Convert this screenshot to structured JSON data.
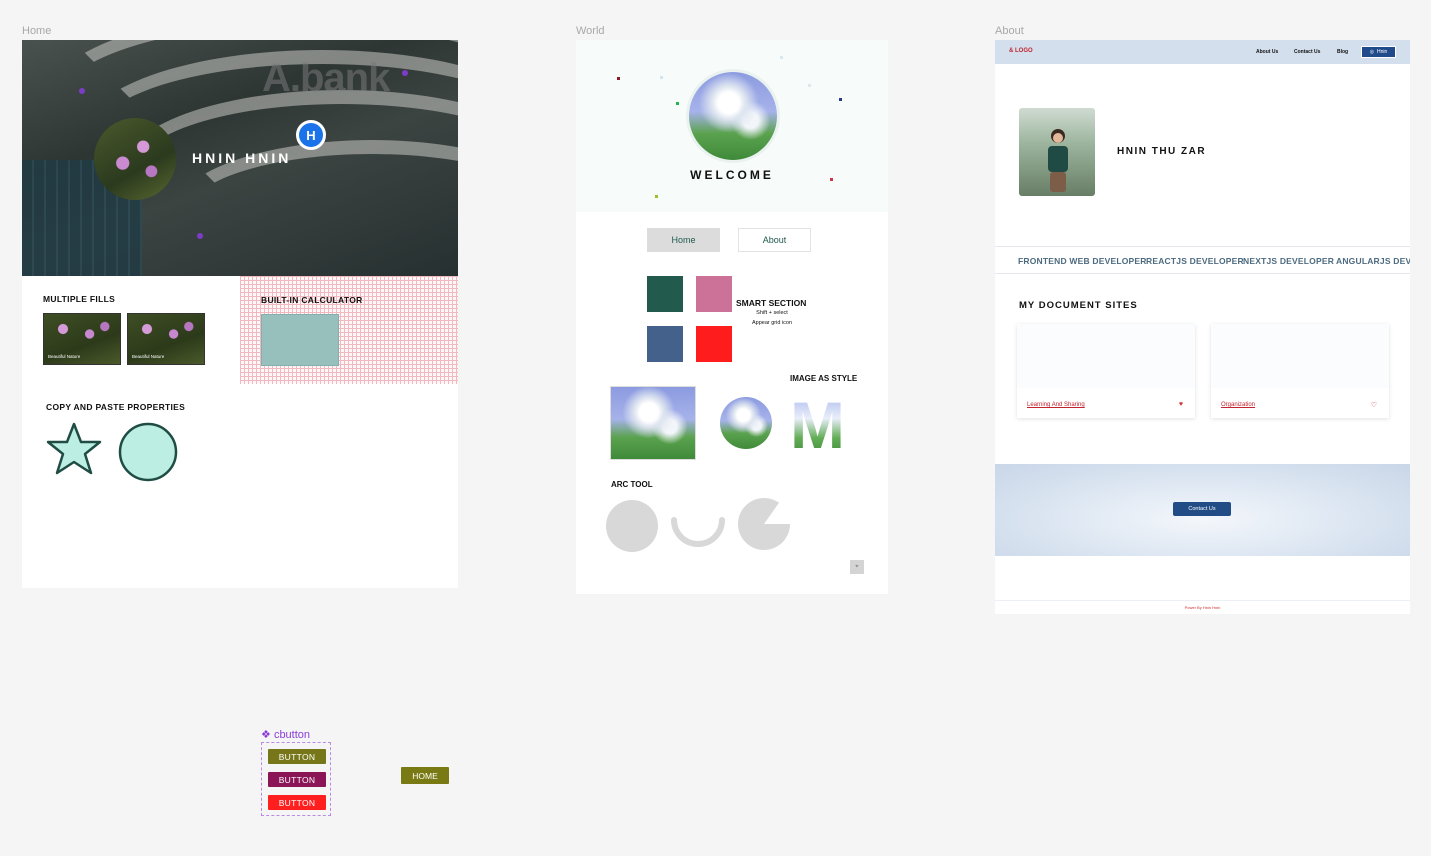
{
  "frames": {
    "home_label": "Home",
    "world_label": "World",
    "about_label": "About"
  },
  "home": {
    "hero_brand": "A.bank",
    "name": "HNIN HNIN",
    "badge_letter": "H",
    "multiple_fills_title": "MULTIPLE  FILLS",
    "fill_card_1": "Beautiful Nature",
    "fill_card_2": "Beautiful Nature",
    "calculator_title": "BUILT-IN CALCULATOR",
    "copy_paste_title": "COPY AND PASTE PROPERTIES"
  },
  "world": {
    "welcome": "WELCOME",
    "nav_home": "Home",
    "nav_about": "About",
    "smart_title": "SMART SECTION",
    "smart_line_1": "Shift + select",
    "smart_line_2": "Appear grid icon",
    "image_style_title": "IMAGE AS STYLE",
    "letter": "M",
    "arc_title": "ARC TOOL",
    "swatches": [
      "#225a4e",
      "#cc7298",
      "#44618c",
      "#ff1c1c"
    ]
  },
  "about": {
    "logo": "LOGO",
    "nav_about_us": "About Us",
    "nav_contact_us": "Contact Us",
    "nav_blog": "Blog",
    "user_button": "Hnin",
    "name": "HNIN  THU ZAR",
    "skills": [
      "FRONTEND WEB DEVELOPER",
      "REACTJS DEVELOPER",
      "NEXTJS DEVELOPER",
      "ANGULARJS DEVELOPER"
    ],
    "documents_title": "MY DOCUMENT SITES",
    "doc_1_link": "Learning And Sharing",
    "doc_2_link": "Organization",
    "contact_button": "Contact Us",
    "footer": "Power By Hnin Hnin"
  },
  "component": {
    "name": "cbutton",
    "buttons": [
      {
        "label": "BUTTON",
        "color": "#77771a"
      },
      {
        "label": "BUTTON",
        "color": "#8b1657"
      },
      {
        "label": "BUTTON",
        "color": "#ff1f1f"
      }
    ],
    "home_button": "HOME"
  }
}
